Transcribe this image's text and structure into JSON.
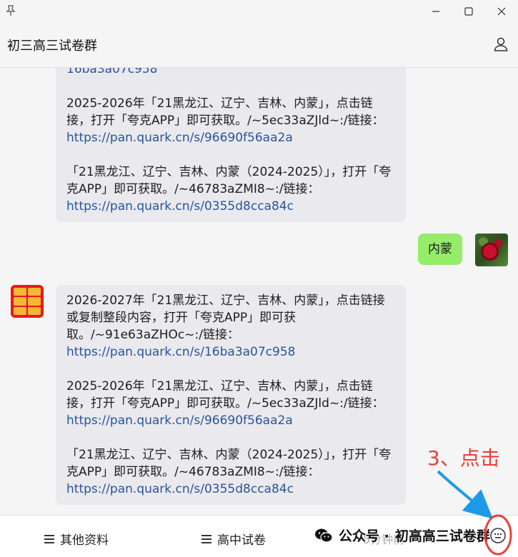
{
  "window": {
    "pin_icon": "pin-icon",
    "minimize_icon": "minimize-icon",
    "maximize_icon": "maximize-icon",
    "close_icon": "close-icon"
  },
  "header": {
    "title": "初三高三试卷群",
    "user_icon": "user-icon"
  },
  "messages": [
    {
      "type": "incoming",
      "partial_top": "16ba3a07c958",
      "p2_text": "2025-2026年「21黑龙江、辽宁、吉林、内蒙」，点击链接，打开「夸克APP」即可获取。/~5ec33aZJld~:/链接：",
      "p2_link": "https://pan.quark.cn/s/96690f56aa2a",
      "p3_text": "「21黑龙江、辽宁、吉林、内蒙（2024-2025）」，打开「夸克APP」即可获取。/~46783aZMI8~:/链接：",
      "p3_link": "https://pan.quark.cn/s/0355d8cca84c"
    },
    {
      "type": "outgoing",
      "text": "内蒙"
    },
    {
      "type": "incoming",
      "p1_text": "2026-2027年「21黑龙江、辽宁、吉林、内蒙」，点击链接或复制整段内容，打开「夸克APP」即可获取。/~91e63aZHOc~:/链接：",
      "p1_link": "https://pan.quark.cn/s/16ba3a07c958",
      "p2_text": "2025-2026年「21黑龙江、辽宁、吉林、内蒙」，点击链接，打开「夸克APP」即可获取。/~5ec33aZJld~:/链接：",
      "p2_link": "https://pan.quark.cn/s/96690f56aa2a",
      "p3_text": "「21黑龙江、辽宁、吉林、内蒙（2024-2025）」，打开「夸克APP」即可获取。/~46783aZMI8~:/链接：",
      "p3_link": "https://pan.quark.cn/s/0355d8cca84c"
    }
  ],
  "bottom": {
    "menu1": "其他资料",
    "menu2": "高中试卷",
    "watermark_prefix": "公众号 · ",
    "watermark_name": "初高高三试卷群",
    "watermark_time": "5分钟前",
    "keyboard_icon": "keyboard-icon"
  },
  "annotation": {
    "text": "3、点击",
    "color": "#e8403a"
  }
}
